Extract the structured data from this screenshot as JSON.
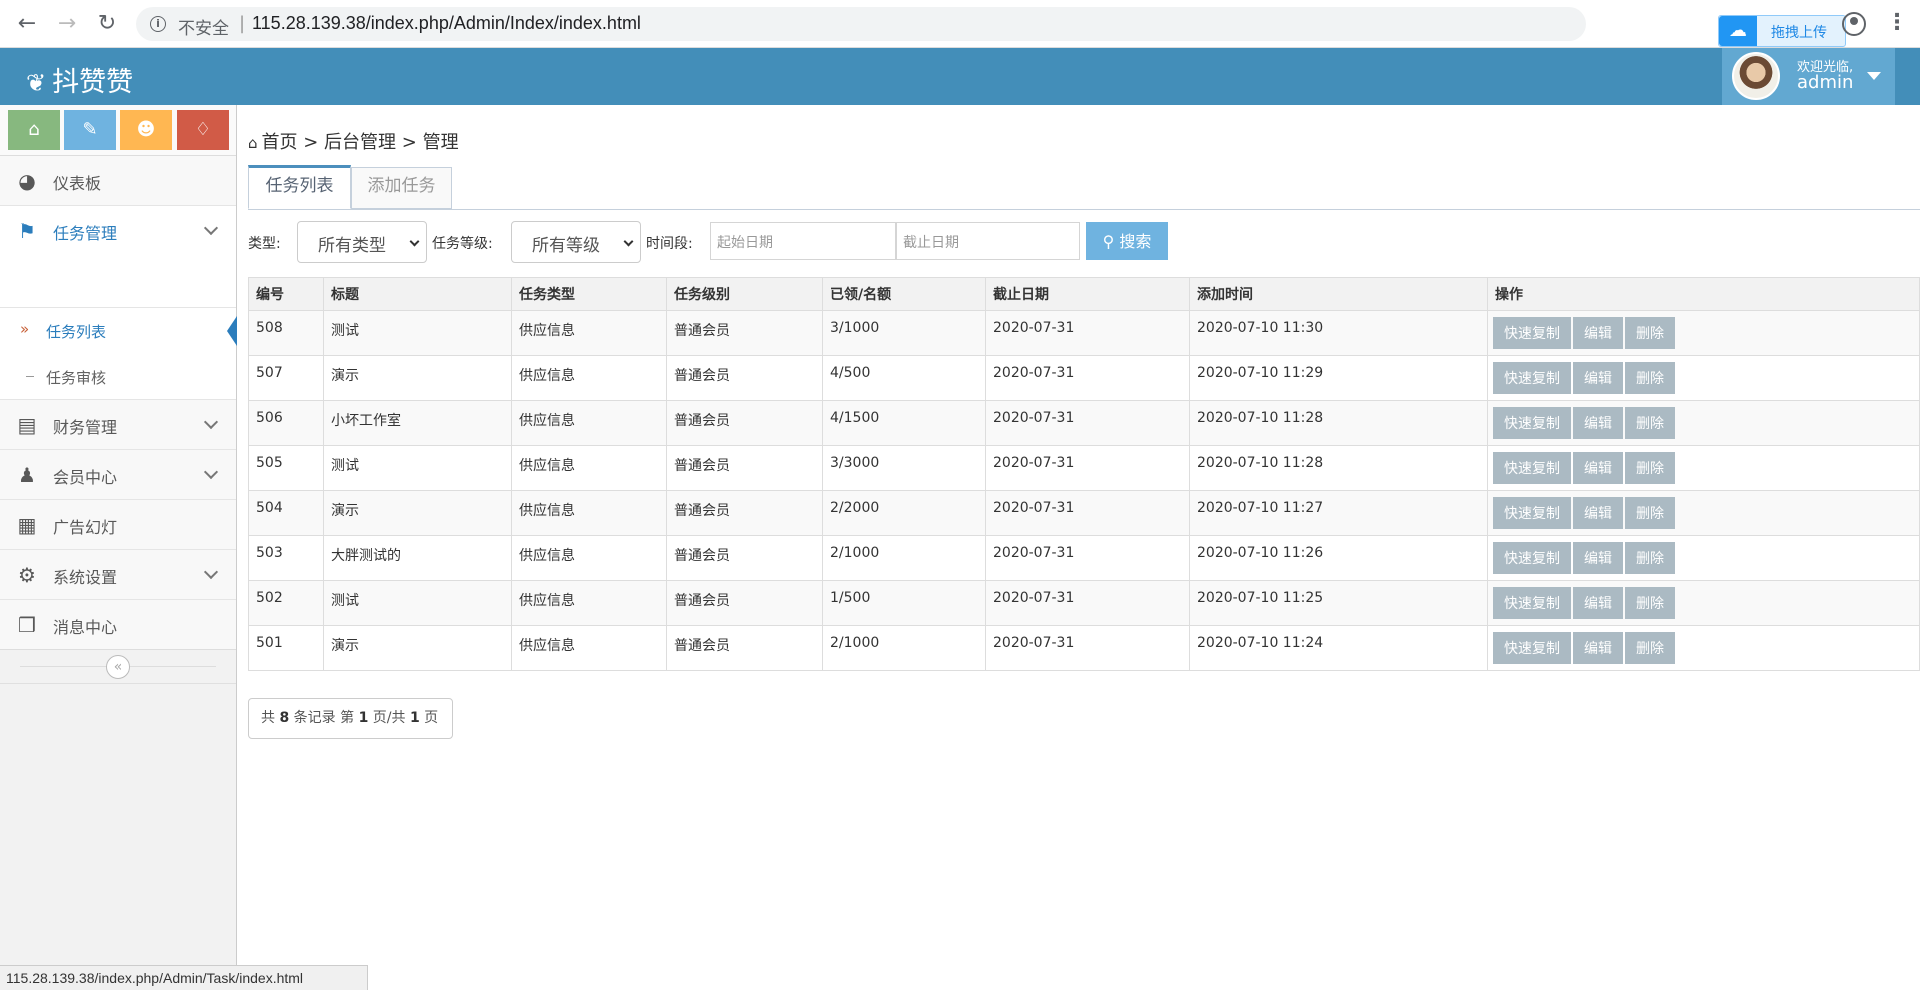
{
  "browser": {
    "insecure_label": "不安全",
    "separator": "|",
    "url": "115.28.139.38/index.php/Admin/Index/index.html",
    "extension_label": "拖拽上传",
    "status_url": "115.28.139.38/index.php/Admin/Task/index.html"
  },
  "header": {
    "logo_text": "抖赞赞",
    "welcome": "欢迎光临,",
    "username": "admin",
    "bg_color": "#438eb9"
  },
  "sidebar": {
    "shortcut_colors": [
      "#87b87f",
      "#6fb3e0",
      "#ffb752",
      "#d15b47"
    ],
    "items": [
      {
        "label": "仪表板",
        "icon": "dashboard-icon"
      },
      {
        "label": "任务管理",
        "icon": "flag-icon"
      },
      {
        "label": "财务管理",
        "icon": "drive-icon"
      },
      {
        "label": "会员中心",
        "icon": "user-icon"
      },
      {
        "label": "广告幻灯",
        "icon": "picture-icon"
      },
      {
        "label": "系统设置",
        "icon": "gear-icon"
      },
      {
        "label": "消息中心",
        "icon": "bookmark-icon"
      }
    ],
    "sub_items": [
      {
        "label": "任务列表"
      },
      {
        "label": "任务审核"
      }
    ],
    "collapse_glyph": "«"
  },
  "main": {
    "breadcrumb": "首页 > 后台管理 > 管理",
    "tabs": [
      {
        "label": "任务列表"
      },
      {
        "label": "添加任务"
      }
    ],
    "filter": {
      "type_label": "类型:",
      "type_value": "所有类型",
      "level_label": "任务等级:",
      "level_value": "所有等级",
      "period_label": "时间段:",
      "start_placeholder": "起始日期",
      "end_placeholder": "截止日期",
      "search_label": "搜索"
    },
    "table": {
      "headers": [
        "编号",
        "标题",
        "任务类型",
        "任务级别",
        "已领/名额",
        "截止日期",
        "添加时间",
        "操作"
      ],
      "rows": [
        [
          "508",
          "测试",
          "供应信息",
          "普通会员",
          "3/1000",
          "2020-07-31",
          "2020-07-10 11:30"
        ],
        [
          "507",
          "演示",
          "供应信息",
          "普通会员",
          "4/500",
          "2020-07-31",
          "2020-07-10 11:29"
        ],
        [
          "506",
          "小坏工作室",
          "供应信息",
          "普通会员",
          "4/1500",
          "2020-07-31",
          "2020-07-10 11:28"
        ],
        [
          "505",
          "测试",
          "供应信息",
          "普通会员",
          "3/3000",
          "2020-07-31",
          "2020-07-10 11:28"
        ],
        [
          "504",
          "演示",
          "供应信息",
          "普通会员",
          "2/2000",
          "2020-07-31",
          "2020-07-10 11:27"
        ],
        [
          "503",
          "大胖测试的",
          "供应信息",
          "普通会员",
          "2/1000",
          "2020-07-31",
          "2020-07-10 11:26"
        ],
        [
          "502",
          "测试",
          "供应信息",
          "普通会员",
          "1/500",
          "2020-07-31",
          "2020-07-10 11:25"
        ],
        [
          "501",
          "演示",
          "供应信息",
          "普通会员",
          "2/1000",
          "2020-07-31",
          "2020-07-10 11:24"
        ]
      ],
      "actions": [
        "快速复制",
        "编辑",
        "删除"
      ]
    },
    "pager": {
      "prefix": "共",
      "total": "8",
      "mid1": "条记录 第",
      "page": "1",
      "mid2": "页/共",
      "pages": "1",
      "suffix": "页"
    }
  }
}
